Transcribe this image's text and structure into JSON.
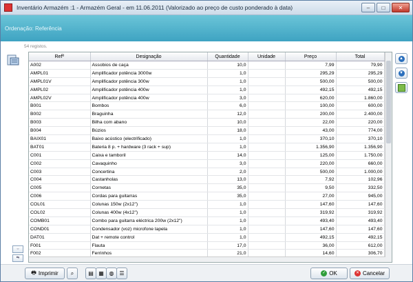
{
  "window": {
    "title": "Inventário Armazém :1 - Armazém Geral - em 11.06.2011 (Valorizado ao preço de custo ponderado à data)"
  },
  "banner": {
    "ordering": "Ordenação: Referência"
  },
  "records": "54 registos.",
  "table": {
    "headers": [
      "Refª",
      "Designação",
      "Quantidade",
      "Unidade",
      "Preço",
      "Total"
    ],
    "rows": [
      [
        "A002",
        "Assobios de caça",
        "10,0",
        "",
        "7,99",
        "79,90"
      ],
      [
        "AMPL01",
        "Amplificador potência 3000w",
        "1,0",
        "",
        "295,29",
        "295,29"
      ],
      [
        "AMPL01V",
        "Amplificador potência 300w",
        "1,0",
        "",
        "500,00",
        "500,00"
      ],
      [
        "AMPL02",
        "Amplificador potência 400w",
        "1,0",
        "",
        "492,15",
        "492,15"
      ],
      [
        "AMPL02V",
        "Amplificador potência 400w",
        "3,0",
        "",
        "620,00",
        "1.860,00"
      ],
      [
        "B001",
        "Bombos",
        "6,0",
        "",
        "100,00",
        "600,00"
      ],
      [
        "B002",
        "Braguinha",
        "12,0",
        "",
        "200,00",
        "2.400,00"
      ],
      [
        "B003",
        "Bilha com abano",
        "10,0",
        "",
        "22,00",
        "220,00"
      ],
      [
        "B004",
        "Búzios",
        "18,0",
        "",
        "43,00",
        "774,00"
      ],
      [
        "BAIX01",
        "Baixo acústico (electrificado)",
        "1,0",
        "",
        "370,10",
        "370,10"
      ],
      [
        "BAT01",
        "Bateria 8 p. + hardware (3 rack + sup)",
        "1,0",
        "",
        "1.356,90",
        "1.356,90"
      ],
      [
        "C001",
        "Caixa e tamboril",
        "14,0",
        "",
        "125,00",
        "1.750,00"
      ],
      [
        "C002",
        "Cavaquinho",
        "3,0",
        "",
        "220,00",
        "660,00"
      ],
      [
        "C003",
        "Concertina",
        "2,0",
        "",
        "500,00",
        "1.000,00"
      ],
      [
        "C004",
        "Castanholas",
        "13,0",
        "",
        "7,92",
        "102,96"
      ],
      [
        "C005",
        "Cornetas",
        "35,0",
        "",
        "9,50",
        "332,50"
      ],
      [
        "C006",
        "Cordas para guitarras",
        "35,0",
        "",
        "27,00",
        "945,00"
      ],
      [
        "COL01",
        "Colunas 150w (2x12\")",
        "1,0",
        "",
        "147,60",
        "147,60"
      ],
      [
        "COL02",
        "Colunas 400w (4x12\")",
        "1,0",
        "",
        "319,92",
        "319,92"
      ],
      [
        "COMB01",
        "Combo para guitarra eléctrica 200w (2x12\")",
        "1,0",
        "",
        "493,40",
        "493,40"
      ],
      [
        "COND01",
        "Condensador (voz) microfone lapela",
        "1,0",
        "",
        "147,60",
        "147,60"
      ],
      [
        "DAT01",
        "Dat + remote control",
        "1,0",
        "",
        "492,15",
        "492,15"
      ],
      [
        "F001",
        "Flauta",
        "17,0",
        "",
        "36,00",
        "612,00"
      ],
      [
        "F002",
        "Ferrinhos",
        "21,0",
        "",
        "14,60",
        "306,70"
      ]
    ]
  },
  "footer": {
    "print_label": "Imprimir",
    "ok_label": "OK",
    "cancel_label": "Cancelar"
  },
  "icons": {
    "app": "app-icon",
    "report": "report-icon",
    "up": "arrow-up-icon",
    "down": "arrow-down-icon",
    "export": "export-icon"
  }
}
